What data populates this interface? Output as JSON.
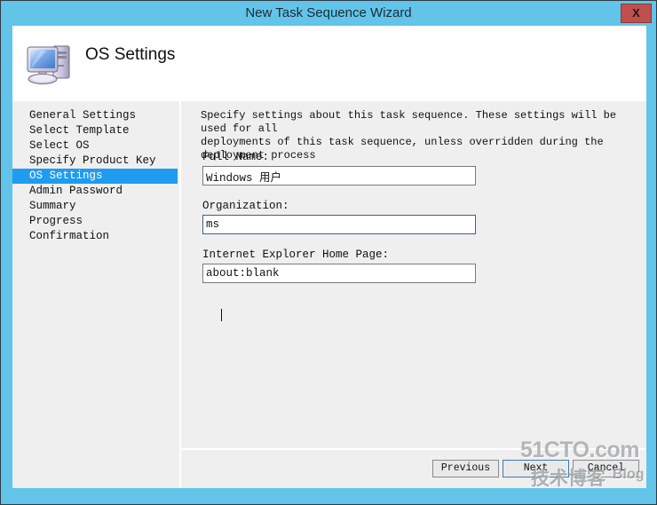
{
  "window": {
    "title": "New Task Sequence Wizard",
    "close_label": "X",
    "frame_color": "#62c4e8",
    "close_color": "#c0504d"
  },
  "header": {
    "title": "OS Settings",
    "icon": "computer-icon"
  },
  "sidebar": {
    "selected_index": 4,
    "highlight_color": "#1f9cf0",
    "items": [
      {
        "label": "General Settings"
      },
      {
        "label": "Select Template"
      },
      {
        "label": "Select OS"
      },
      {
        "label": "Specify Product Key"
      },
      {
        "label": "OS Settings"
      },
      {
        "label": "Admin Password"
      },
      {
        "label": "Summary"
      },
      {
        "label": "Progress"
      },
      {
        "label": "Confirmation"
      }
    ]
  },
  "content": {
    "intro_line1": "Specify settings about this task sequence.  These settings will be used for all",
    "intro_line2": "deployments of this task sequence, unless overridden during the deployment process",
    "fields": [
      {
        "label": "Full Name:",
        "value": "Windows 用户",
        "focused": false
      },
      {
        "label": "Organization:",
        "value": "ms",
        "focused": true
      },
      {
        "label": "Internet Explorer Home Page:",
        "value": "about:blank",
        "focused": false
      }
    ]
  },
  "footer": {
    "previous_label": "Previous",
    "next_label": "Next",
    "cancel_label": "Cancel"
  },
  "watermark": {
    "top": "51CTO.com",
    "bottom": "技术博客",
    "blog": "Blog"
  }
}
